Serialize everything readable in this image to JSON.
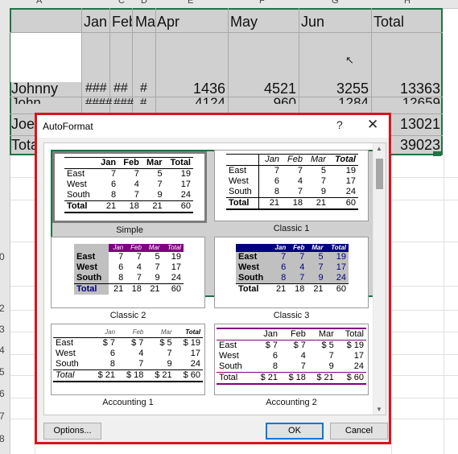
{
  "sheet": {
    "col_headers": [
      "A",
      "C",
      "D",
      "E",
      "F",
      "G",
      "H"
    ],
    "row_headers": [
      "0",
      "2",
      "3",
      "4",
      "5",
      "6",
      "7",
      "8"
    ],
    "header_row": [
      "Jan",
      "Feb",
      "Mar",
      "Apr",
      "May",
      "Jun",
      "Total"
    ],
    "rows": [
      {
        "label": "Johnny",
        "cells": [
          "###",
          "##",
          "#",
          "1436",
          "4521",
          "3255",
          "13363"
        ]
      },
      {
        "label": "John",
        "cells": [
          "####",
          "###",
          "#",
          "4124",
          "960",
          "1284",
          "12659"
        ]
      },
      {
        "label": "Joe",
        "cells": [
          "",
          "",
          "",
          "",
          "",
          "",
          "13021"
        ]
      },
      {
        "label": "Tota",
        "cells": [
          "",
          "",
          "",
          "",
          "",
          "",
          "39023"
        ]
      }
    ]
  },
  "dialog": {
    "title": "AutoFormat",
    "help": "?",
    "close": "✕",
    "formats": [
      {
        "name": "Simple",
        "hdr": [
          "",
          "Jan",
          "Feb",
          "Mar",
          "Total"
        ],
        "rows": [
          [
            "East",
            "7",
            "7",
            "5",
            "19"
          ],
          [
            "West",
            "6",
            "4",
            "7",
            "17"
          ],
          [
            "South",
            "8",
            "7",
            "9",
            "24"
          ],
          [
            "Total",
            "21",
            "18",
            "21",
            "60"
          ]
        ]
      },
      {
        "name": "Classic 1",
        "hdr": [
          "",
          "Jan",
          "Feb",
          "Mar",
          "Total"
        ],
        "rows": [
          [
            "East",
            "7",
            "7",
            "5",
            "19"
          ],
          [
            "West",
            "6",
            "4",
            "7",
            "17"
          ],
          [
            "South",
            "8",
            "7",
            "9",
            "24"
          ],
          [
            "Total",
            "21",
            "18",
            "21",
            "60"
          ]
        ]
      },
      {
        "name": "Classic 2",
        "hdr": [
          "",
          "Jan",
          "Feb",
          "Mar",
          "Total"
        ],
        "rows": [
          [
            "East",
            "7",
            "7",
            "5",
            "19"
          ],
          [
            "West",
            "6",
            "4",
            "7",
            "17"
          ],
          [
            "South",
            "8",
            "7",
            "9",
            "24"
          ],
          [
            "Total",
            "21",
            "18",
            "21",
            "60"
          ]
        ]
      },
      {
        "name": "Classic 3",
        "hdr": [
          "",
          "Jan",
          "Feb",
          "Mar",
          "Total"
        ],
        "rows": [
          [
            "East",
            "7",
            "7",
            "5",
            "19"
          ],
          [
            "West",
            "6",
            "4",
            "7",
            "17"
          ],
          [
            "South",
            "8",
            "7",
            "9",
            "24"
          ],
          [
            "Total",
            "21",
            "18",
            "21",
            "60"
          ]
        ]
      },
      {
        "name": "Accounting 1",
        "hdr": [
          "",
          "Jan",
          "Feb",
          "Mar",
          "Total"
        ],
        "rows": [
          [
            "East",
            "$ 7",
            "$ 7",
            "$ 5",
            "$ 19"
          ],
          [
            "West",
            "6",
            "4",
            "7",
            "17"
          ],
          [
            "South",
            "8",
            "7",
            "9",
            "24"
          ],
          [
            "Total",
            "$ 21",
            "$ 18",
            "$ 21",
            "$ 60"
          ]
        ]
      },
      {
        "name": "Accounting 2",
        "hdr": [
          "",
          "Jan",
          "Feb",
          "Mar",
          "Total"
        ],
        "rows": [
          [
            "East",
            "$ 7",
            "$ 7",
            "$ 5",
            "$ 19"
          ],
          [
            "West",
            "6",
            "4",
            "7",
            "17"
          ],
          [
            "South",
            "8",
            "7",
            "9",
            "24"
          ],
          [
            "Total",
            "$ 21",
            "$ 18",
            "$ 21",
            "$ 60"
          ]
        ]
      }
    ],
    "buttons": {
      "options": "Options...",
      "ok": "OK",
      "cancel": "Cancel"
    }
  },
  "colors": {
    "dialog_border": "#d9141b",
    "selection": "#217346",
    "classic2_header": "#800080",
    "classic3_header": "#000080",
    "ok_border": "#0078d7"
  }
}
